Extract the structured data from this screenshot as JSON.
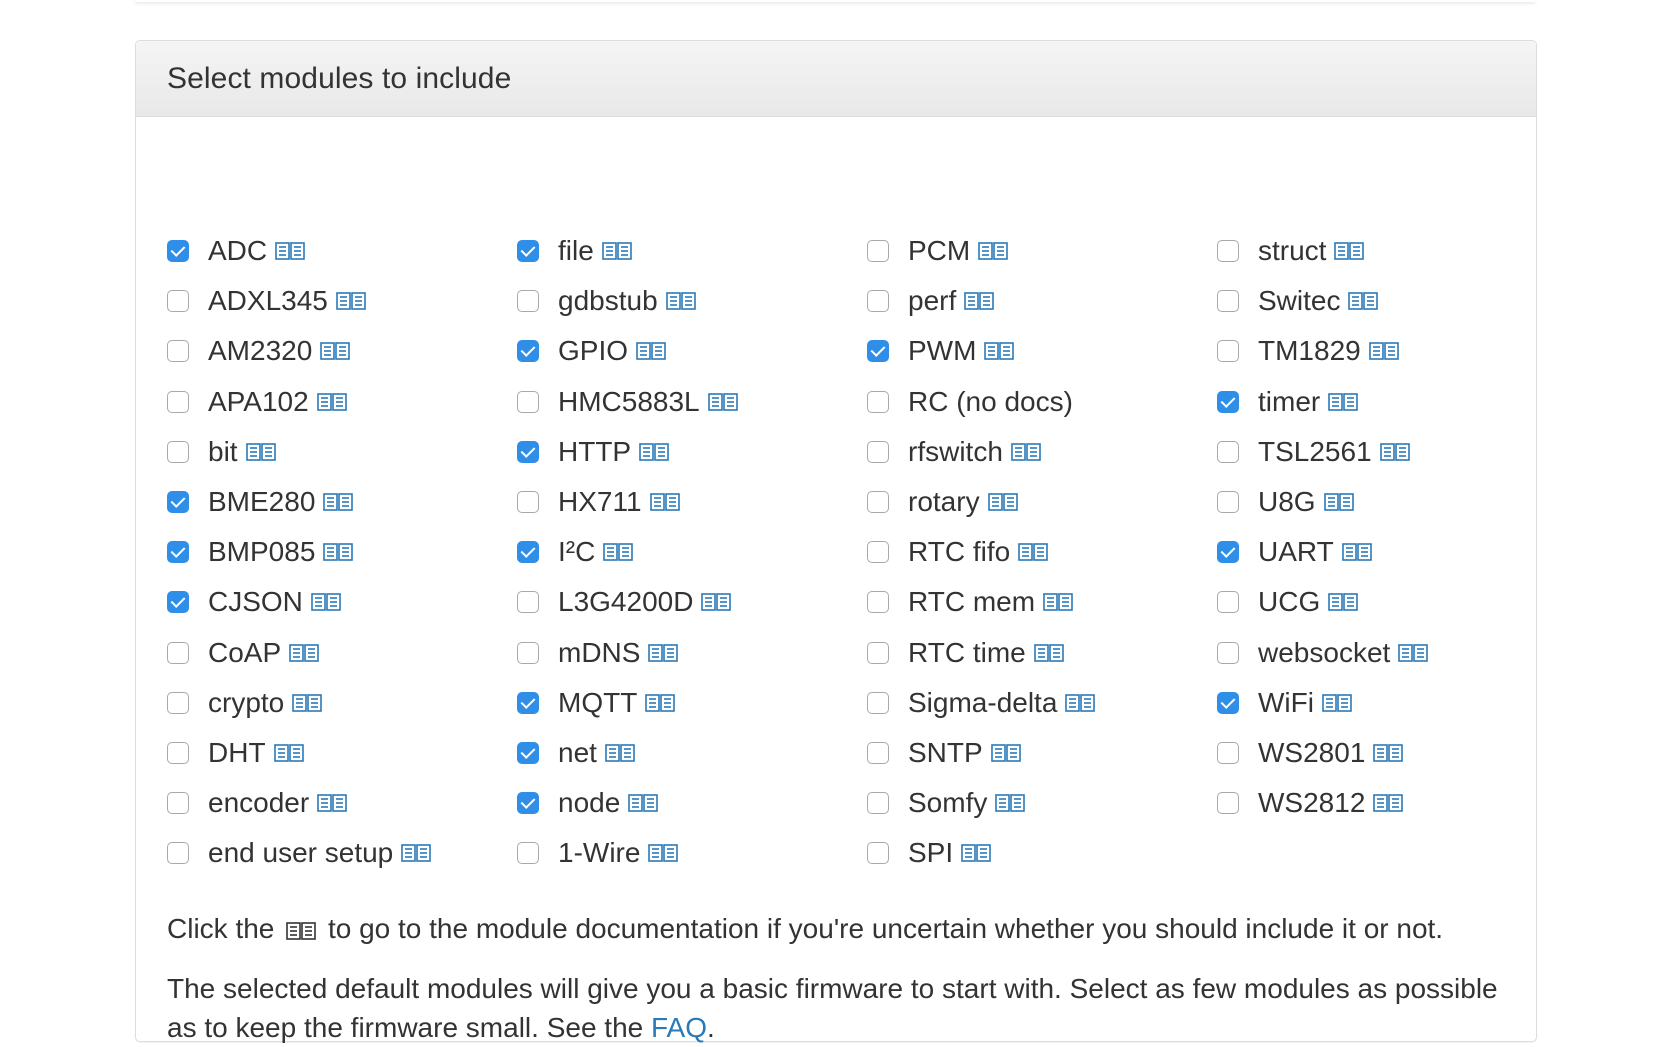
{
  "panel": {
    "title": "Select modules to include"
  },
  "modules": [
    {
      "label": "ADC",
      "checked": true,
      "docs": true
    },
    {
      "label": "file",
      "checked": true,
      "docs": true
    },
    {
      "label": "PCM",
      "checked": false,
      "docs": true
    },
    {
      "label": "struct",
      "checked": false,
      "docs": true
    },
    {
      "label": "ADXL345",
      "checked": false,
      "docs": true
    },
    {
      "label": "gdbstub",
      "checked": false,
      "docs": true
    },
    {
      "label": "perf",
      "checked": false,
      "docs": true
    },
    {
      "label": "Switec",
      "checked": false,
      "docs": true
    },
    {
      "label": "AM2320",
      "checked": false,
      "docs": true
    },
    {
      "label": "GPIO",
      "checked": true,
      "docs": true
    },
    {
      "label": "PWM",
      "checked": true,
      "docs": true
    },
    {
      "label": "TM1829",
      "checked": false,
      "docs": true
    },
    {
      "label": "APA102",
      "checked": false,
      "docs": true
    },
    {
      "label": "HMC5883L",
      "checked": false,
      "docs": true
    },
    {
      "label": "RC (no docs)",
      "checked": false,
      "docs": false
    },
    {
      "label": "timer",
      "checked": true,
      "docs": true
    },
    {
      "label": "bit",
      "checked": false,
      "docs": true
    },
    {
      "label": "HTTP",
      "checked": true,
      "docs": true
    },
    {
      "label": "rfswitch",
      "checked": false,
      "docs": true
    },
    {
      "label": "TSL2561",
      "checked": false,
      "docs": true
    },
    {
      "label": "BME280",
      "checked": true,
      "docs": true
    },
    {
      "label": "HX711",
      "checked": false,
      "docs": true
    },
    {
      "label": "rotary",
      "checked": false,
      "docs": true
    },
    {
      "label": "U8G",
      "checked": false,
      "docs": true
    },
    {
      "label": "BMP085",
      "checked": true,
      "docs": true
    },
    {
      "label": "I²C",
      "checked": true,
      "docs": true
    },
    {
      "label": "RTC fifo",
      "checked": false,
      "docs": true
    },
    {
      "label": "UART",
      "checked": true,
      "docs": true
    },
    {
      "label": "CJSON",
      "checked": true,
      "docs": true
    },
    {
      "label": "L3G4200D",
      "checked": false,
      "docs": true
    },
    {
      "label": "RTC mem",
      "checked": false,
      "docs": true
    },
    {
      "label": "UCG",
      "checked": false,
      "docs": true
    },
    {
      "label": "CoAP",
      "checked": false,
      "docs": true
    },
    {
      "label": "mDNS",
      "checked": false,
      "docs": true
    },
    {
      "label": "RTC time",
      "checked": false,
      "docs": true
    },
    {
      "label": "websocket",
      "checked": false,
      "docs": true
    },
    {
      "label": "crypto",
      "checked": false,
      "docs": true
    },
    {
      "label": "MQTT",
      "checked": true,
      "docs": true
    },
    {
      "label": "Sigma-delta",
      "checked": false,
      "docs": true
    },
    {
      "label": "WiFi",
      "checked": true,
      "docs": true
    },
    {
      "label": "DHT",
      "checked": false,
      "docs": true
    },
    {
      "label": "net",
      "checked": true,
      "docs": true
    },
    {
      "label": "SNTP",
      "checked": false,
      "docs": true
    },
    {
      "label": "WS2801",
      "checked": false,
      "docs": true
    },
    {
      "label": "encoder",
      "checked": false,
      "docs": true
    },
    {
      "label": "node",
      "checked": true,
      "docs": true
    },
    {
      "label": "Somfy",
      "checked": false,
      "docs": true
    },
    {
      "label": "WS2812",
      "checked": false,
      "docs": true
    },
    {
      "label": "end user setup",
      "checked": false,
      "docs": true
    },
    {
      "label": "1-Wire",
      "checked": false,
      "docs": true
    },
    {
      "label": "SPI",
      "checked": false,
      "docs": true
    }
  ],
  "help": {
    "before": "Click the",
    "after": "to go to the module documentation if you're uncertain whether you should include it or not."
  },
  "note": {
    "text": "The selected default modules will give you a basic firmware to start with. Select as few modules as possible as to keep the firmware small. See the",
    "link": "FAQ",
    "end": "."
  },
  "colors": {
    "checkbox_checked": "#2f8fe8",
    "book_icon": "#2a7ab8",
    "link": "#2a7ab8"
  },
  "icons": {
    "checkbox": "checkbox-icon",
    "docs": "book-icon"
  }
}
